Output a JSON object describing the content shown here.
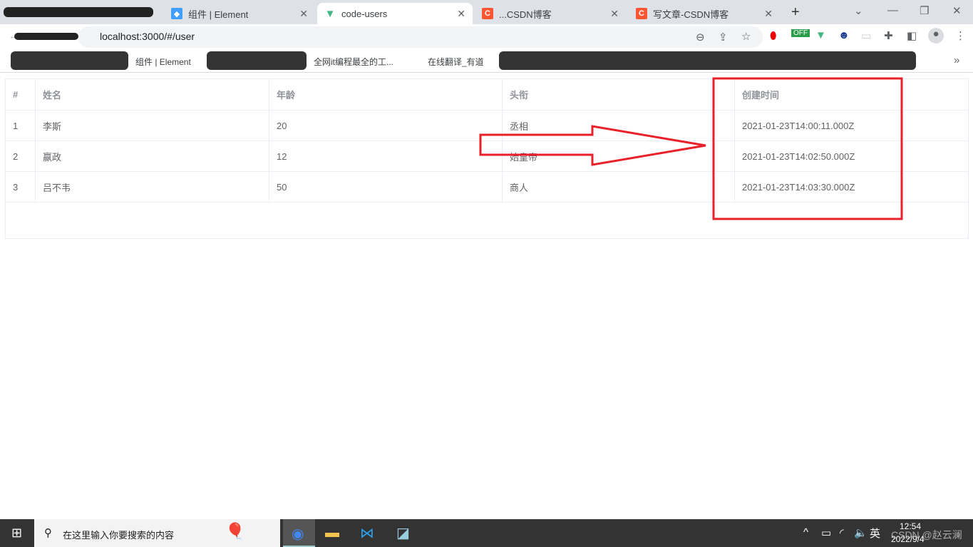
{
  "browser": {
    "tabs": [
      {
        "title": "组件 | Element",
        "active": false
      },
      {
        "title": "code-users",
        "active": true
      },
      {
        "title": "...CSDN博客",
        "active": false
      },
      {
        "title": "写文章-CSDN博客",
        "active": false
      }
    ],
    "url": "localhost:3000/#/user",
    "bookmarks": [
      "组件 | Element",
      "全网it编程最全的工...",
      "在线翻译_有道"
    ],
    "more": "»"
  },
  "table": {
    "columns": [
      "#",
      "姓名",
      "年龄",
      "头衔",
      "创建时间"
    ],
    "rows": [
      [
        "1",
        "李斯",
        "20",
        "丞相",
        "2021-01-23T14:00:11.000Z"
      ],
      [
        "2",
        "嬴政",
        "12",
        "始皇帝",
        "2021-01-23T14:02:50.000Z"
      ],
      [
        "3",
        "吕不韦",
        "50",
        "商人",
        "2021-01-23T14:03:30.000Z"
      ]
    ]
  },
  "annotation_color": "#e8202a",
  "taskbar": {
    "search_placeholder": "在这里输入你要搜索的内容",
    "ime": "英",
    "time": "12:54",
    "date": "2022/9/4",
    "watermark": "CSDN @赵云澜"
  }
}
